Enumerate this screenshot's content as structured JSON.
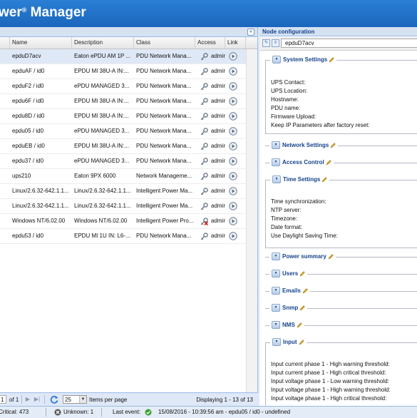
{
  "header": {
    "brand": "wer",
    "reg": "®",
    "brand2": " Manager"
  },
  "grid": {
    "columns": [
      "Name",
      "Description",
      "Class",
      "Access",
      "Link"
    ],
    "rows": [
      {
        "name": "epduD7acv",
        "description": "Eaton ePDU AM 1P ...",
        "class": "PDU Network Mana...",
        "access": "admir",
        "access_status": "ok",
        "selected": true
      },
      {
        "name": "epduAF / id0",
        "description": "EPDU MI 38U-A IN:...",
        "class": "PDU Network Mana...",
        "access": "admir",
        "access_status": "ok"
      },
      {
        "name": "epduF2 / id0",
        "description": "ePDU MANAGED 3...",
        "class": "PDU Network Mana...",
        "access": "admir",
        "access_status": "ok"
      },
      {
        "name": "epdu6F / id0",
        "description": "EPDU MI 38U-A IN:...",
        "class": "PDU Network Mana...",
        "access": "admir",
        "access_status": "ok"
      },
      {
        "name": "epdu8D / id0",
        "description": "EPDU MI 38U-A IN:...",
        "class": "PDU Network Mana...",
        "access": "admir",
        "access_status": "ok"
      },
      {
        "name": "epdu05 / id0",
        "description": "ePDU MANAGED 3...",
        "class": "PDU Network Mana...",
        "access": "admir",
        "access_status": "ok"
      },
      {
        "name": "epduEB / id0",
        "description": "EPDU MI 38U-A IN:...",
        "class": "PDU Network Mana...",
        "access": "admir",
        "access_status": "ok"
      },
      {
        "name": "epdu37 / id0",
        "description": "ePDU MANAGED 3...",
        "class": "PDU Network Mana...",
        "access": "admir",
        "access_status": "ok"
      },
      {
        "name": "ups210",
        "description": "Eaton 9PX 6000",
        "class": "Network Manageme...",
        "access": "admir",
        "access_status": "ok"
      },
      {
        "name": "Linux/2.6.32-642.1.1...",
        "description": "Linux/2.6.32-642.1.1...",
        "class": "Intelligent Power Ma...",
        "access": "admir",
        "access_status": "ok"
      },
      {
        "name": "Linux/2.6.32-642.1.1...",
        "description": "Linux/2.6.32-642.1.1...",
        "class": "Intelligent Power Ma...",
        "access": "admir",
        "access_status": "ok"
      },
      {
        "name": "Windows NT/6.02.00",
        "description": "Windows NT/6.02.00",
        "class": "Intelligent Power Pro...",
        "access": "admir",
        "access_status": "error"
      },
      {
        "name": "epdu53 / id0",
        "description": "EPDU MI 1U IN: L6-...",
        "class": "PDU Network Mana...",
        "access": "admir",
        "access_status": "ok"
      }
    ]
  },
  "pager": {
    "page": "1",
    "of_label": "of 1",
    "page_size": "25",
    "page_size_label": "Items per page",
    "displaying": "Displaying 1 - 13 of 13"
  },
  "node_config": {
    "title": "Node configuration",
    "node_name": "epduD7acv",
    "system_settings": {
      "legend": "System Settings",
      "fields": [
        "UPS Contact:",
        "UPS Location:",
        "Hostname:",
        "PDU name:",
        "Firmware Upload:",
        "Keep IP Parameters after factory reset:"
      ]
    },
    "network_settings": {
      "legend": "Network Settings"
    },
    "access_control": {
      "legend": "Access Control"
    },
    "time_settings": {
      "legend": "Time Settings",
      "fields": [
        "Time synchronization:",
        "NTP server:",
        "Timezone:",
        "Date format:",
        "Use Daylight Saving Time:"
      ]
    },
    "collapsed_sections": [
      {
        "legend": "Power summary"
      },
      {
        "legend": "Users"
      },
      {
        "legend": "Emails"
      },
      {
        "legend": "Snmp"
      },
      {
        "legend": "NMS"
      }
    ],
    "input": {
      "legend": "Input",
      "fields": [
        "Input current phase 1 - High warning threshold:",
        "Input current phase 1 - High critical threshold:",
        "Input voltage phase 1 - Low warning threshold:",
        "Input voltage phase 1 - High warning threshold:",
        "Input voltage phase 1 - High critical threshold:"
      ]
    }
  },
  "statusbar": {
    "critical": "Critical: 473",
    "unknown": "Unknown: 1",
    "last_event_label": "Last event:",
    "last_event": "15/08/2016 - 10:39:56 am - epdu05 / id0 - undefined"
  },
  "colors": {
    "header": "#1a66bd",
    "panel_header": "#d5e2f2",
    "legend": "#15428b",
    "ok": "#4caf2a",
    "error": "#cc2222"
  }
}
